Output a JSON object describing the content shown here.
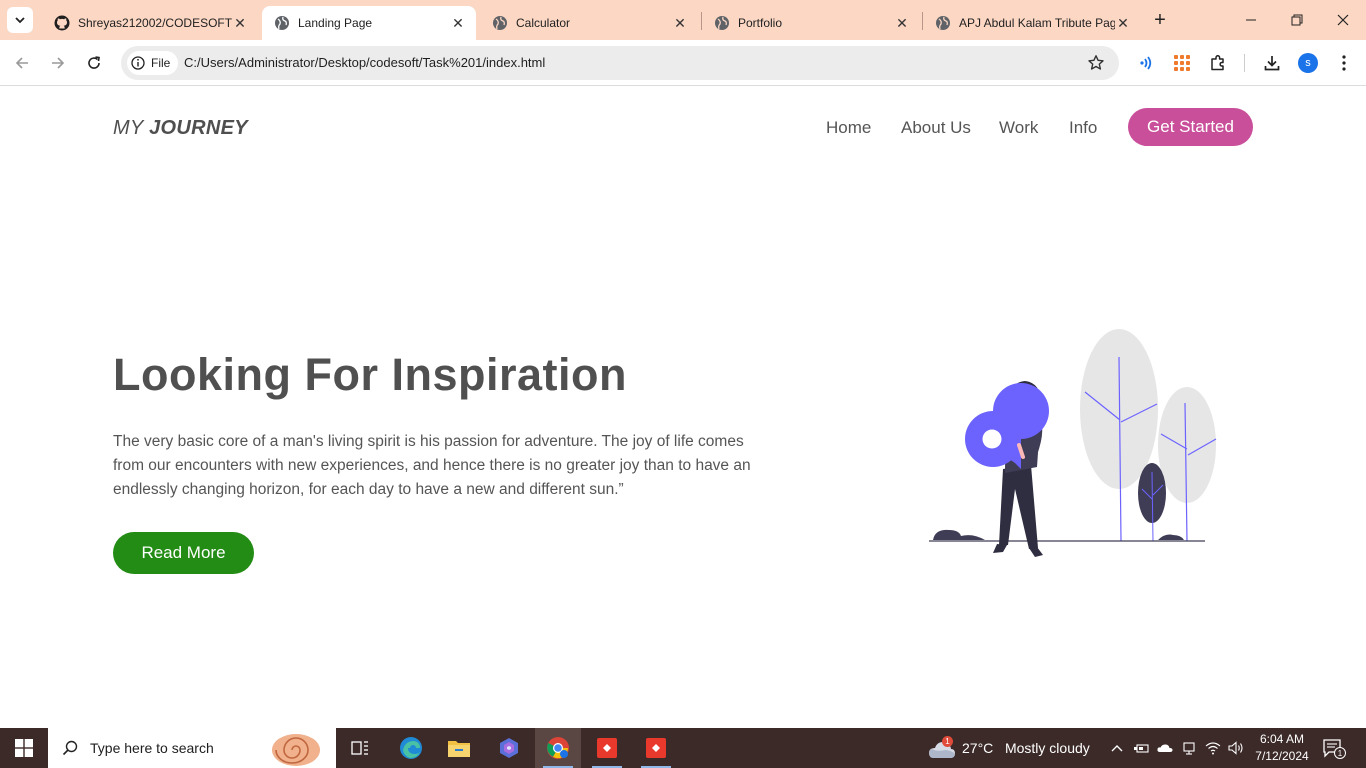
{
  "browser": {
    "tabs": [
      {
        "title": "Shreyas212002/CODESOFT_\\",
        "favicon": "github-icon",
        "active": false
      },
      {
        "title": "Landing Page",
        "favicon": "globe-icon",
        "active": true
      },
      {
        "title": "Calculator",
        "favicon": "globe-icon",
        "active": false
      },
      {
        "title": "Portfolio",
        "favicon": "globe-icon",
        "active": false
      },
      {
        "title": "APJ Abdul Kalam Tribute Pag",
        "favicon": "globe-icon",
        "active": false
      }
    ],
    "address": {
      "scheme_label": "File",
      "url": "C:/Users/Administrator/Desktop/codesoft/Task%201/index.html"
    },
    "profile_initial": "s",
    "tabbar_color": "#fbd7c4"
  },
  "page": {
    "logo": {
      "part1": "MY",
      "part2": "JOURNEY"
    },
    "nav": [
      "Home",
      "About Us",
      "Work",
      "Info"
    ],
    "cta_label": "Get Started",
    "headline": "Looking For Inspiration",
    "paragraph": "The very basic core of a man's living spirit is his passion for adventure. The joy of life comes from our encounters with new experiences, and hence there is no greater joy than to have an endlessly changing horizon, for each day to have a new and different sun.”",
    "read_more_label": "Read More",
    "colors": {
      "cta": "#c94f9a",
      "read_more": "#238c14",
      "accent": "#6c63ff",
      "text": "#505050"
    }
  },
  "taskbar": {
    "search_placeholder": "Type here to search",
    "weather": {
      "temp": "27°C",
      "condition": "Mostly cloudy",
      "alerts": "1"
    },
    "time": "6:04 AM",
    "date": "7/12/2024",
    "notifications": "1"
  }
}
